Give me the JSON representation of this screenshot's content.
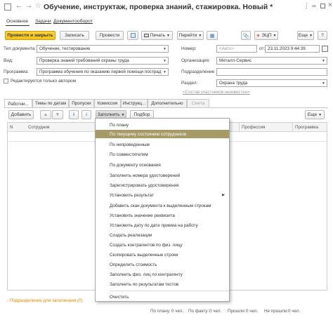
{
  "window": {
    "title": "Обучение, инструктаж, проверка знаний, стажировка. Новый *"
  },
  "nav": {
    "tabs": [
      "Основное",
      "Задачи",
      "Документооборот"
    ]
  },
  "toolbar": {
    "post_close": "Провести и закрыть",
    "save": "Записать",
    "post": "Провести",
    "print": "Печать",
    "goto": "Перейти",
    "ecp": "ЭЦП",
    "more": "Еще"
  },
  "form": {
    "doc_type_label": "Тип документа:",
    "doc_type_value": "Обучение, тестирование",
    "kind_label": "Вид:",
    "kind_value": "Проверка знаний требований охраны труда",
    "program_label": "Программа:",
    "program_value": "Программа обучения по оказанию первой помощи пострад",
    "edit_author_label": "Редактируется только автором",
    "number_label": "Номер:",
    "number_placeholder": "<Авто>",
    "date_from_label": "от:",
    "date_value": "23.11.2023  9:44:39",
    "org_label": "Организация:",
    "org_value": "Металл-Сервис",
    "dept_label": "Подразделение",
    "dept_value": "",
    "section_label": "Раздел:",
    "section_value": "Охрана труда",
    "participants_link": "<Состав участников неизвестен>"
  },
  "tabs": [
    "Работни...",
    "Темы по датам",
    "Пропуски",
    "Комиссия",
    "Инструкц...",
    "Дополнительно",
    "Смета"
  ],
  "table_toolbar": {
    "add": "Добавить",
    "fill": "Заполнить",
    "select": "Подбор",
    "more": "Еще"
  },
  "table": {
    "columns": [
      "N",
      "Сотрудник",
      "Профессия",
      "Программа"
    ]
  },
  "fill_menu": {
    "items": [
      "По плану",
      "По текущему состоянию сотрудников",
      "По непроведенным",
      "По совместителям",
      "По документу основания",
      "Заполнить номера удостоверений",
      "Зарегистрировать удостоверения",
      "Установить результат",
      "Добавить скан документа к выделенным строкам",
      "Установить значение реквизита",
      "Установить дату по дате приема на работу",
      "Создать реализации",
      "Создать контрагентов по физ. лицу",
      "Скопировать выделенные строки",
      "Определить стоимость",
      "Заполнить физ. лиц по контрагенту",
      "Заполнить по результатам тестов",
      "Очистить"
    ],
    "highlighted_index": 1,
    "highlight_color": "#a69a67"
  },
  "footer": {
    "fill_link": "Подразделение для заполнения (0)",
    "plan": "По плану:",
    "plan_val": "0 чел.",
    "fact": "По факту:",
    "fact_val": "0 чел.",
    "passed": "Прошли:",
    "passed_val": "0 чел.",
    "failed": "Не прошли:",
    "failed_val": "0 чел."
  },
  "colors": {
    "accent_yellow": "#f4c314",
    "link_orange": "#e08a00",
    "menu_highlight": "#a69a67"
  }
}
